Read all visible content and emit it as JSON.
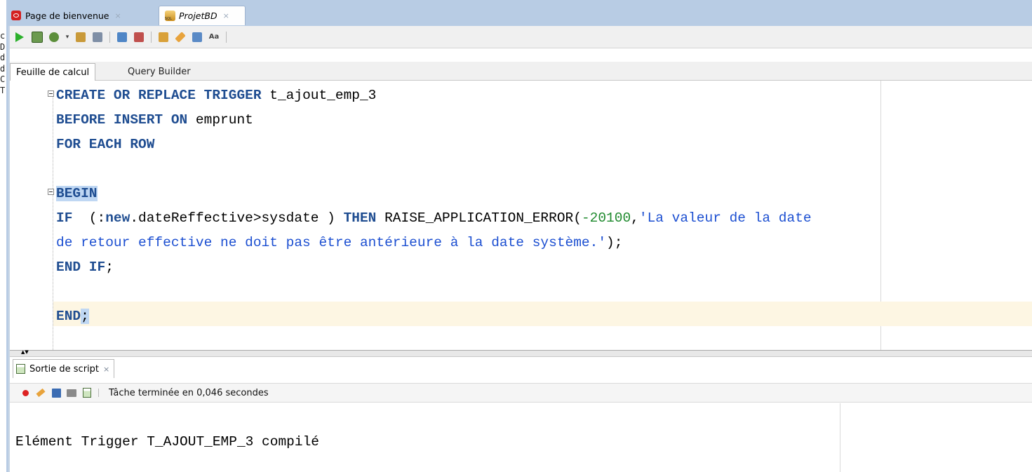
{
  "tabs": {
    "welcome": "Page de bienvenue",
    "project": "ProjetBD",
    "close_glyph": "×"
  },
  "side_letters": [
    "c",
    "D",
    "d",
    "d",
    "C",
    "T"
  ],
  "sub_tabs": {
    "worksheet": "Feuille de calcul",
    "query_builder": "Query Builder"
  },
  "editor": {
    "lines": {
      "l1": {
        "kw": "CREATE OR REPLACE TRIGGER",
        "rest": " t_ajout_emp_3"
      },
      "l2": {
        "kw": "BEFORE INSERT ON",
        "rest": " emprunt"
      },
      "l3": {
        "kw": "FOR EACH ROW"
      },
      "l5": {
        "kw": "BEGIN"
      },
      "l6": {
        "kw_if": "IF",
        "t1": "  (:",
        "kw_new": "new",
        "t2": ".dateReffective>sysdate ) ",
        "kw_then": "THEN",
        "t3": " RAISE_APPLICATION_ERROR(",
        "num": "-20100",
        "t4": ",",
        "str": "'La valeur de la date"
      },
      "l7": {
        "str": "de retour effective ne doit pas être antérieure à la date système.'",
        "rest": ");"
      },
      "l8": {
        "kw": "END IF",
        "rest": ";"
      },
      "l10": {
        "kw": "END",
        "rest": ";"
      }
    }
  },
  "output_panel": {
    "tab_label": "Sortie de script",
    "status": "Tâche terminée en 0,046 secondes",
    "message": "Elément Trigger T_AJOUT_EMP_3 compilé"
  },
  "colors": {
    "keyword": "#1f4d91",
    "string": "#1c4fd1",
    "number": "#1f8a2e",
    "tabbar": "#b8cce4",
    "current_line": "#fdf6e3"
  }
}
